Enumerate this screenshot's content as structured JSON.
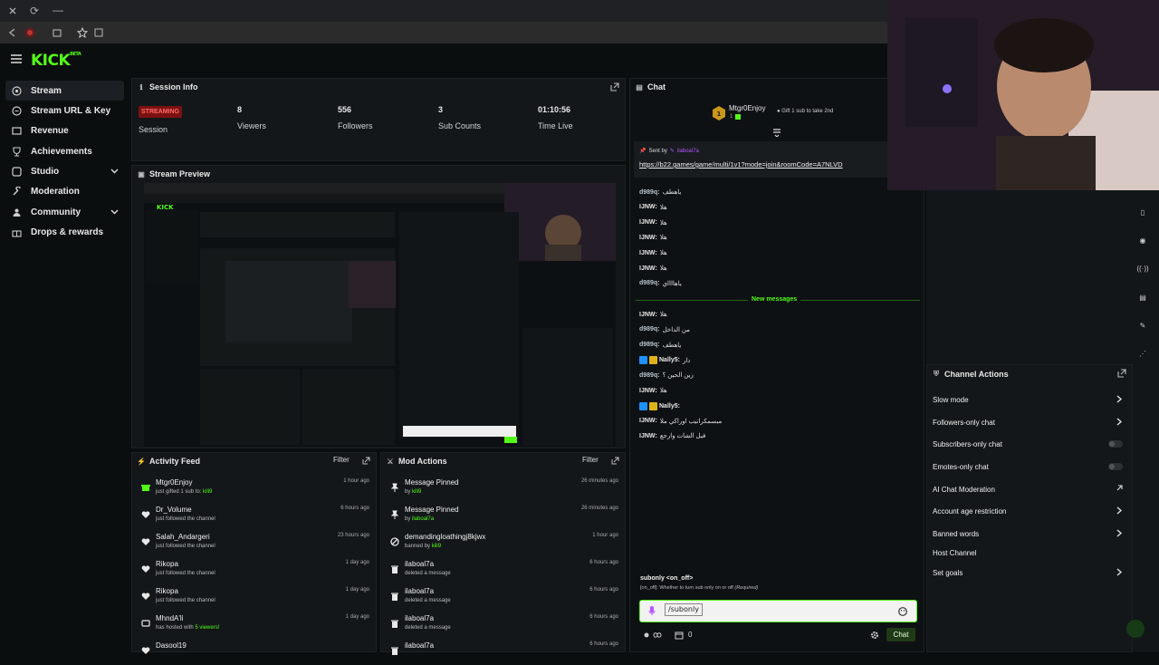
{
  "browser": {
    "reload": "⟳",
    "minimize": "—"
  },
  "sidebar": {
    "items": [
      {
        "label": "Stream",
        "icon": "stream-icon"
      },
      {
        "label": "Stream URL & Key",
        "icon": "key-icon"
      },
      {
        "label": "Revenue",
        "icon": "revenue-icon"
      },
      {
        "label": "Achievements",
        "icon": "trophy-icon"
      },
      {
        "label": "Studio",
        "icon": "studio-icon"
      },
      {
        "label": "Moderation",
        "icon": "wrench-icon"
      },
      {
        "label": "Community",
        "icon": "community-icon"
      },
      {
        "label": "Drops & rewards",
        "icon": "gift-icon"
      }
    ]
  },
  "session": {
    "title": "Session Info",
    "status": "STREAMING",
    "status_label": "Session",
    "stats": [
      {
        "value": "8",
        "label": "Viewers"
      },
      {
        "value": "556",
        "label": "Followers"
      },
      {
        "value": "3",
        "label": "Sub Counts"
      },
      {
        "value": "01:10:56",
        "label": "Time Live"
      }
    ]
  },
  "preview": {
    "title": "Stream Preview"
  },
  "activity": {
    "title": "Activity Feed",
    "filter": "Filter",
    "rows": [
      {
        "name": "Mtgr0Enjoy",
        "sub": "just gifted 1 sub to:",
        "target": "kili9",
        "time": "1 hour ago",
        "icon": "gift-icon"
      },
      {
        "name": "Dr_Volume",
        "sub": "just followed the channel",
        "target": "",
        "time": "6 hours ago",
        "icon": "heart-icon"
      },
      {
        "name": "Salah_Andargeri",
        "sub": "just followed the channel",
        "target": "",
        "time": "23 hours ago",
        "icon": "heart-icon"
      },
      {
        "name": "Rikopa",
        "sub": "just followed the channel",
        "target": "",
        "time": "1 day ago",
        "icon": "heart-icon"
      },
      {
        "name": "Rikopa",
        "sub": "just followed the channel",
        "target": "",
        "time": "1 day ago",
        "icon": "heart-icon"
      },
      {
        "name": "MhndA'li",
        "sub": "has hosted with",
        "target": "5 viewers!",
        "time": "1 day ago",
        "icon": "host-icon"
      },
      {
        "name": "Dasool19",
        "sub": "",
        "target": "",
        "time": "",
        "icon": "heart-icon"
      }
    ]
  },
  "mod": {
    "title": "Mod Actions",
    "filter": "Filter",
    "rows": [
      {
        "name": "Message Pinned",
        "by": "by",
        "who": "kili9",
        "time": "26 minutes ago",
        "icon": "pin-icon"
      },
      {
        "name": "Message Pinned",
        "by": "by",
        "who": "ilaboal7a",
        "time": "26 minutes ago",
        "icon": "pin-icon"
      },
      {
        "name": "demandingloathingj8kjwx",
        "by": "banned by",
        "who": "kili9",
        "time": "1 hour ago",
        "icon": "ban-icon"
      },
      {
        "name": "ilaboal7a",
        "by": "deleted a message",
        "who": "",
        "time": "6 hours ago",
        "icon": "trash-icon"
      },
      {
        "name": "ilaboal7a",
        "by": "deleted a message",
        "who": "",
        "time": "6 hours ago",
        "icon": "trash-icon"
      },
      {
        "name": "ilaboal7a",
        "by": "deleted a message",
        "who": "",
        "time": "6 hours ago",
        "icon": "trash-icon"
      },
      {
        "name": "ilaboal7a",
        "by": "",
        "who": "",
        "time": "6 hours ago",
        "icon": "trash-icon"
      }
    ]
  },
  "chat": {
    "title": "Chat",
    "gift_user": "Mtgr0Enjoy",
    "gift_count": "1",
    "gift_text": "Gift 1 sub to take 2nd",
    "pinned_sent_by": "Sent by",
    "pinned_user": "ilaboal7a",
    "pinned_link": "https://b22.games/game/multi/1v1?mode=join&roomCode=A7NLVD",
    "messages_before": [
      {
        "user": "d989q",
        "msg": "ياهطف",
        "style": "g"
      },
      {
        "user": "IJNW",
        "msg": "هلا",
        "style": ""
      },
      {
        "user": "IJNW",
        "msg": "هلا",
        "style": ""
      },
      {
        "user": "IJNW",
        "msg": "هلا",
        "style": ""
      },
      {
        "user": "IJNW",
        "msg": "هلا",
        "style": ""
      },
      {
        "user": "IJNW",
        "msg": "هلا",
        "style": ""
      },
      {
        "user": "d989q",
        "msg": "ياهااااي",
        "style": "g"
      }
    ],
    "new_messages": "New messages",
    "messages_after": [
      {
        "user": "IJNW",
        "msg": "هلا",
        "style": "",
        "badge": false
      },
      {
        "user": "d989q",
        "msg": "من الداخل",
        "style": "g",
        "badge": false
      },
      {
        "user": "d989q",
        "msg": "ياهطف",
        "style": "g",
        "badge": false
      },
      {
        "user": "Nally5",
        "msg": "دار",
        "style": "",
        "badge": true
      },
      {
        "user": "d989q",
        "msg": "زين الحين ؟",
        "style": "g",
        "badge": false
      },
      {
        "user": "IJNW",
        "msg": "هلا",
        "style": "",
        "badge": false
      },
      {
        "user": "Nally5",
        "msg": "",
        "style": "",
        "badge": true
      },
      {
        "user": "IJNW",
        "msg": "مبسمكراتيب اوراكي ملا",
        "style": "",
        "badge": false
      },
      {
        "user": "IJNW",
        "msg": "فيل الشات وارجع",
        "style": "",
        "badge": false
      }
    ],
    "cmd_name": "subonly <on_off>",
    "cmd_help_key": "[on_off]:",
    "cmd_help": "Whether to turn sub only on or off",
    "cmd_required": "(Required)",
    "input_value": "/subonly",
    "points": "0",
    "send": "Chat"
  },
  "actions": {
    "title": "Channel Actions",
    "rows": [
      {
        "label": "Slow mode",
        "kind": "chevron"
      },
      {
        "label": "Followers-only chat",
        "kind": "chevron"
      },
      {
        "label": "Subscribers-only chat",
        "kind": "toggle"
      },
      {
        "label": "Emotes-only chat",
        "kind": "toggle"
      },
      {
        "label": "AI Chat Moderation",
        "kind": "external"
      },
      {
        "label": "Account age restriction",
        "kind": "chevron"
      },
      {
        "label": "Banned words",
        "kind": "chevron"
      },
      {
        "label": "Host Channel",
        "kind": "none"
      },
      {
        "label": "Set goals",
        "kind": "chevron"
      }
    ]
  },
  "colors": {
    "brand": "#53fc18",
    "live": "#7b1111",
    "panel": "#131719"
  }
}
